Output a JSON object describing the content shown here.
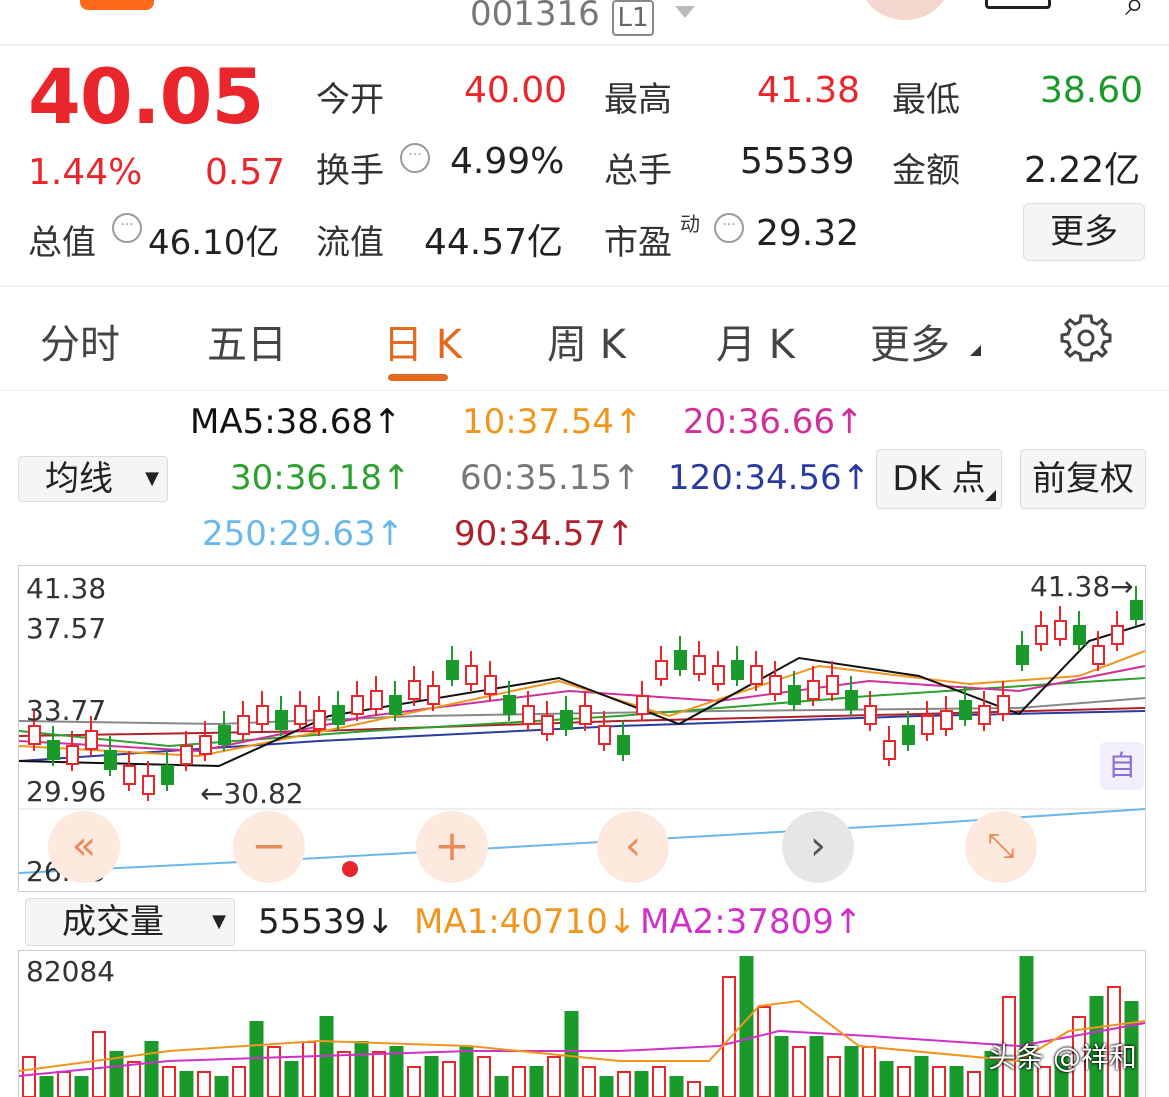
{
  "header": {
    "code": "001316",
    "level": "L1"
  },
  "quote": {
    "price": "40.05",
    "pct": "1.44%",
    "chg": "0.57",
    "open_label": "今开",
    "open": "40.00",
    "high_label": "最高",
    "high": "41.38",
    "low_label": "最低",
    "low": "38.60",
    "turnover_label": "换手",
    "turnover": "4.99%",
    "vol_label": "总手",
    "vol": "55539",
    "amount_label": "金额",
    "amount": "2.22亿",
    "mktcap_label": "总值",
    "mktcap": "46.10亿",
    "float_label": "流值",
    "float": "44.57亿",
    "pe_label": "市盈",
    "pe_sup": "动",
    "pe": "29.32",
    "more": "更多"
  },
  "tabs": [
    {
      "label": "分时"
    },
    {
      "label": "五日"
    },
    {
      "label": "日 K"
    },
    {
      "label": "周 K"
    },
    {
      "label": "月 K"
    },
    {
      "label": "更多"
    }
  ],
  "ma": {
    "selector": "均线",
    "ma5": "MA5:38.68",
    "ma10": "10:37.54",
    "ma20": "20:36.66",
    "ma30": "30:36.18",
    "ma60": "60:35.15",
    "ma120": "120:34.56",
    "ma250": "250:29.63",
    "ma90": "90:34.57",
    "dk": "DK 点",
    "adjust": "前复权",
    "arrow_up": "↑"
  },
  "chart": {
    "y1": "41.38",
    "y2": "37.57",
    "y3": "33.77",
    "y4": "29.96",
    "y5": "26.15",
    "hi_mark": "41.38→",
    "lo_mark": "←30.82",
    "auto": "自"
  },
  "volume": {
    "selector": "成交量",
    "vol": "55539",
    "down": "↓",
    "ma1": "MA1:40710",
    "ma2": "MA2:37809",
    "up": "↑",
    "ymax": "82084"
  },
  "watermark": "头条 @祥和",
  "colors": {
    "up": "#e8262c",
    "down": "#1a9a2a",
    "ma5": "#111111",
    "ma10": "#f0961e",
    "ma20": "#d0309a",
    "ma30": "#2ea02e",
    "ma60": "#888888",
    "ma120": "#2a3ba0",
    "ma250": "#6ab8ea",
    "ma90": "#b0202a"
  }
}
